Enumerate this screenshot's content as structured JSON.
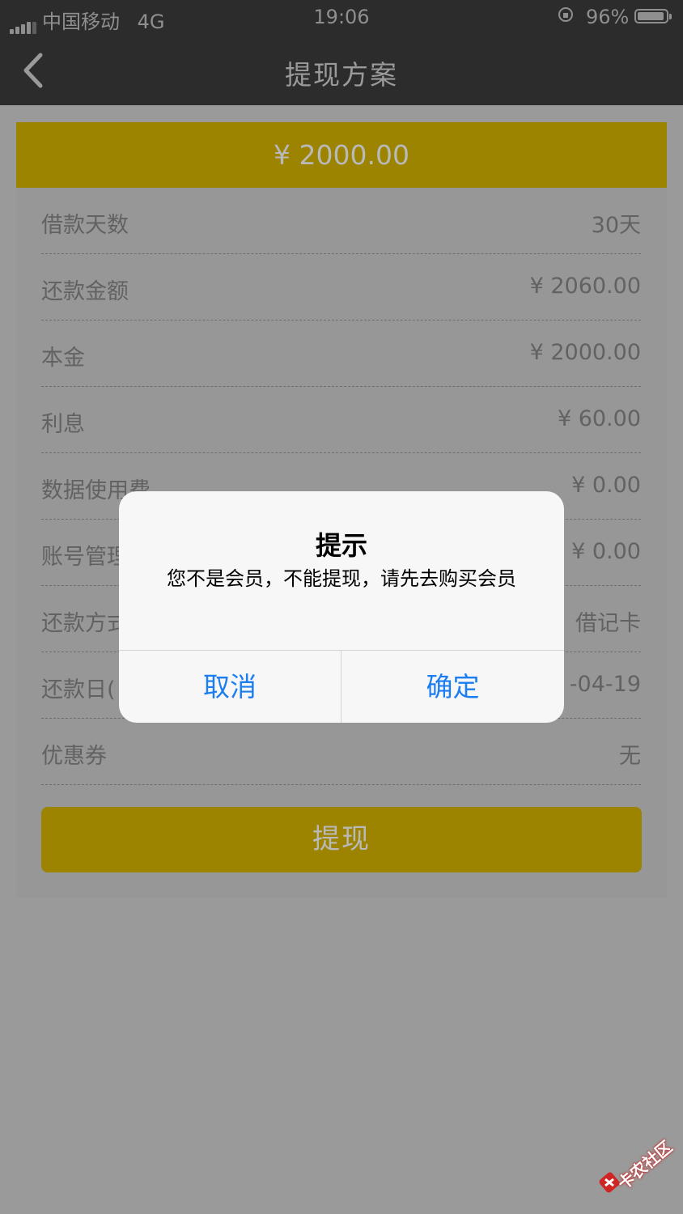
{
  "status_bar": {
    "carrier": "中国移动",
    "network": "4G",
    "time": "19:06",
    "battery": "96%"
  },
  "nav": {
    "title": "提现方案"
  },
  "amount": "¥ 2000.00",
  "rows": [
    {
      "label": "借款天数",
      "value": "30天"
    },
    {
      "label": "还款金额",
      "value": "¥ 2060.00"
    },
    {
      "label": "本金",
      "value": "¥ 2000.00"
    },
    {
      "label": "利息",
      "value": "¥ 60.00"
    },
    {
      "label": "数据使用费",
      "value": "¥ 0.00"
    },
    {
      "label": "账号管理费",
      "value": "¥ 0.00"
    },
    {
      "label": "还款方式",
      "value": "借记卡"
    },
    {
      "label": "还款日(",
      "value": "-04-19"
    },
    {
      "label": "优惠券",
      "value": "无"
    }
  ],
  "withdraw_label": "提现",
  "dialog": {
    "title": "提示",
    "message": "您不是会员，不能提现，请先去购买会员",
    "cancel": "取消",
    "confirm": "确定"
  },
  "watermark": "卡农社区",
  "colors": {
    "accent": "#9c8300",
    "dialog_button": "#1a7df2"
  }
}
